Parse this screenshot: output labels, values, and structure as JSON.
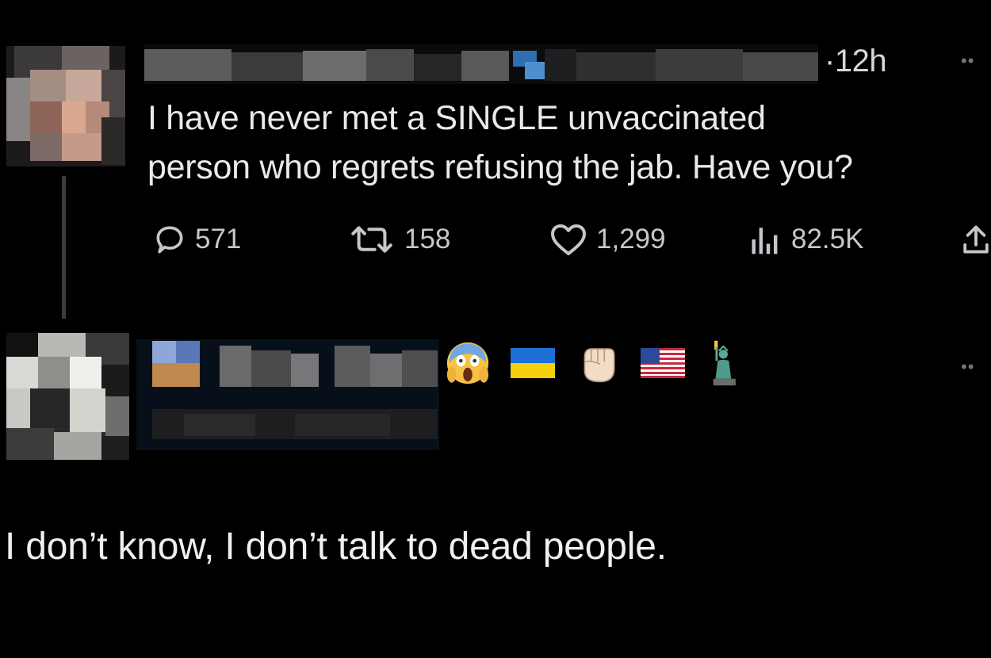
{
  "tweet": {
    "time": "12h",
    "more_icon": "more-dots-icon",
    "text_line1": "I have never met a SINGLE unvaccinated",
    "text_line2": "person who regrets refusing the jab. Have you?",
    "stats": {
      "replies": "571",
      "retweets": "158",
      "likes": "1,299",
      "views": "82.5K"
    }
  },
  "reply": {
    "emojis": [
      "face-screaming-emoji",
      "ukraine-flag-emoji",
      "raised-fist-emoji",
      "us-flag-emoji",
      "statue-of-liberty-emoji"
    ],
    "text": "I don’t know, I don’t talk to dead people."
  },
  "colors": {
    "background": "#000000",
    "text": "#e7e9ea",
    "secondary_text": "#c4c8cc",
    "thread_line": "#3a3d40"
  }
}
